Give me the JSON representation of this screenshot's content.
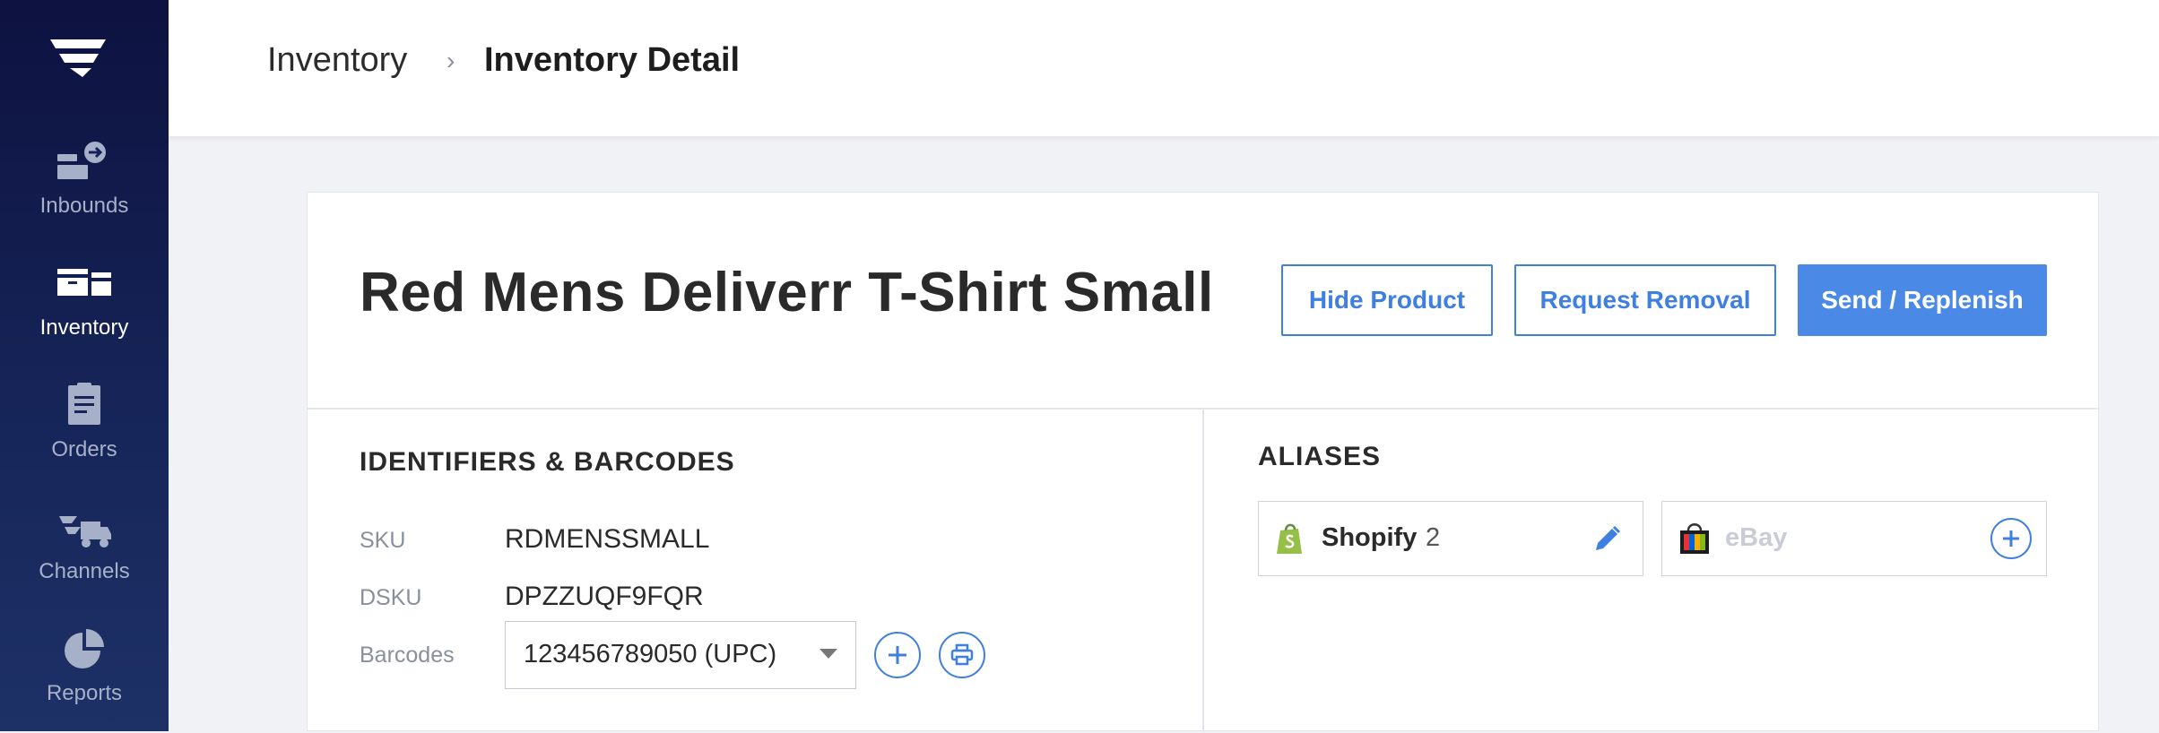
{
  "nav": {
    "items": [
      {
        "label": "Inbounds",
        "icon": "inbound-icon",
        "active": false
      },
      {
        "label": "Inventory",
        "icon": "inventory-icon",
        "active": true
      },
      {
        "label": "Orders",
        "icon": "orders-icon",
        "active": false
      },
      {
        "label": "Channels",
        "icon": "channels-icon",
        "active": false
      },
      {
        "label": "Reports",
        "icon": "reports-icon",
        "active": false
      }
    ]
  },
  "breadcrumb": {
    "root": "Inventory",
    "separator": "›",
    "current": "Inventory Detail"
  },
  "product": {
    "title": "Red Mens Deliverr T-Shirt Small"
  },
  "actions": {
    "hide": "Hide Product",
    "removal": "Request Removal",
    "send": "Send / Replenish"
  },
  "identifiers": {
    "title": "IDENTIFIERS & BARCODES",
    "sku_label": "SKU",
    "sku_value": "RDMENSSMALL",
    "dsku_label": "DSKU",
    "dsku_value": "DPZZUQF9FQR",
    "barcodes_label": "Barcodes",
    "barcode_selected": "123456789050 (UPC)"
  },
  "aliases": {
    "title": "ALIASES",
    "items": [
      {
        "name": "Shopify",
        "count": "2",
        "icon": "shopify-icon",
        "action_icon": "pencil-icon",
        "enabled": true
      },
      {
        "name": "eBay",
        "count": "",
        "icon": "ebay-icon",
        "action_icon": "plus-circle-icon",
        "enabled": false
      }
    ]
  },
  "colors": {
    "accent": "#3f7fe0",
    "primary_button": "#4a8ae6",
    "sidebar_top": "#0d1240",
    "sidebar_bottom": "#1d3167",
    "shopify_green": "#95bf47"
  }
}
